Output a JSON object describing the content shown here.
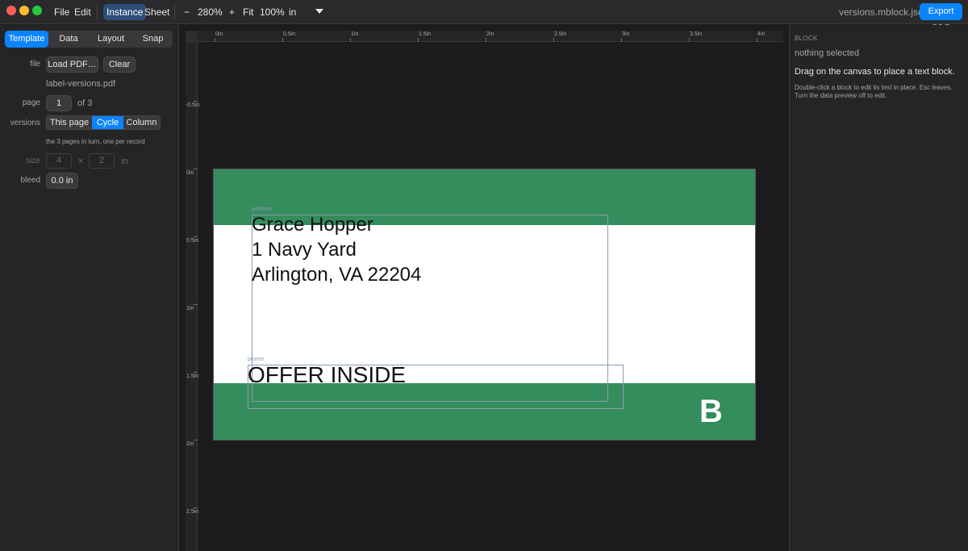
{
  "titlebar": {
    "menu_file": "File",
    "menu_edit": "Edit",
    "mode_instance": "Instance",
    "mode_sheet": "Sheet",
    "zoom_out": "−",
    "zoom_level": "280%",
    "zoom_in": "+",
    "fit": "Fit",
    "hundred": "100%",
    "unit": "in",
    "filename": "versions.mblock.json",
    "export": "Export PDF"
  },
  "left": {
    "tabs": [
      "Template",
      "Data",
      "Layout",
      "Snap"
    ],
    "active_tab": "Template",
    "file_label": "file",
    "load_pdf": "Load PDF…",
    "clear": "Clear",
    "file_name": "label-versions.pdf",
    "page_label": "page",
    "page_value": "1",
    "page_of": "of 3",
    "versions_label": "versions",
    "versions_options": [
      "This page",
      "Cycle",
      "Column"
    ],
    "versions_selected": "Cycle",
    "versions_hint": "the 3 pages in turn, one per record",
    "size_label": "size",
    "size_w": "4",
    "size_x": "×",
    "size_h": "2",
    "size_unit": "in",
    "bleed_label": "bleed",
    "bleed_value": "0.0 in"
  },
  "rulers": {
    "top": [
      "0in",
      "0.5in",
      "1in",
      "1.5in",
      "2in",
      "2.5in",
      "3in",
      "3.5in",
      "4in"
    ],
    "left": [
      "-0.5in",
      "0in",
      "0.5in",
      "1in",
      "1.5in",
      "2in",
      "2.5in"
    ]
  },
  "canvas": {
    "address_tag": "address",
    "address_lines": "Grace Hopper\n1 Navy Yard\nArlington, VA 22204",
    "promo_tag": "promo",
    "promo_text": "OFFER INSIDE",
    "version_letter": "B",
    "band_color": "#358c5c"
  },
  "right": {
    "heading": "BLOCK",
    "selection": "nothing selected",
    "drag_hint": "Drag on the canvas to place a text block.",
    "help": "Double-click a block to edit its text in place. Esc leaves. Turn the data preview off to edit."
  },
  "colors": {
    "accent": "#0a84ff",
    "traffic_red": "#ff5f57",
    "traffic_yellow": "#febc2e",
    "traffic_green": "#28c840"
  }
}
